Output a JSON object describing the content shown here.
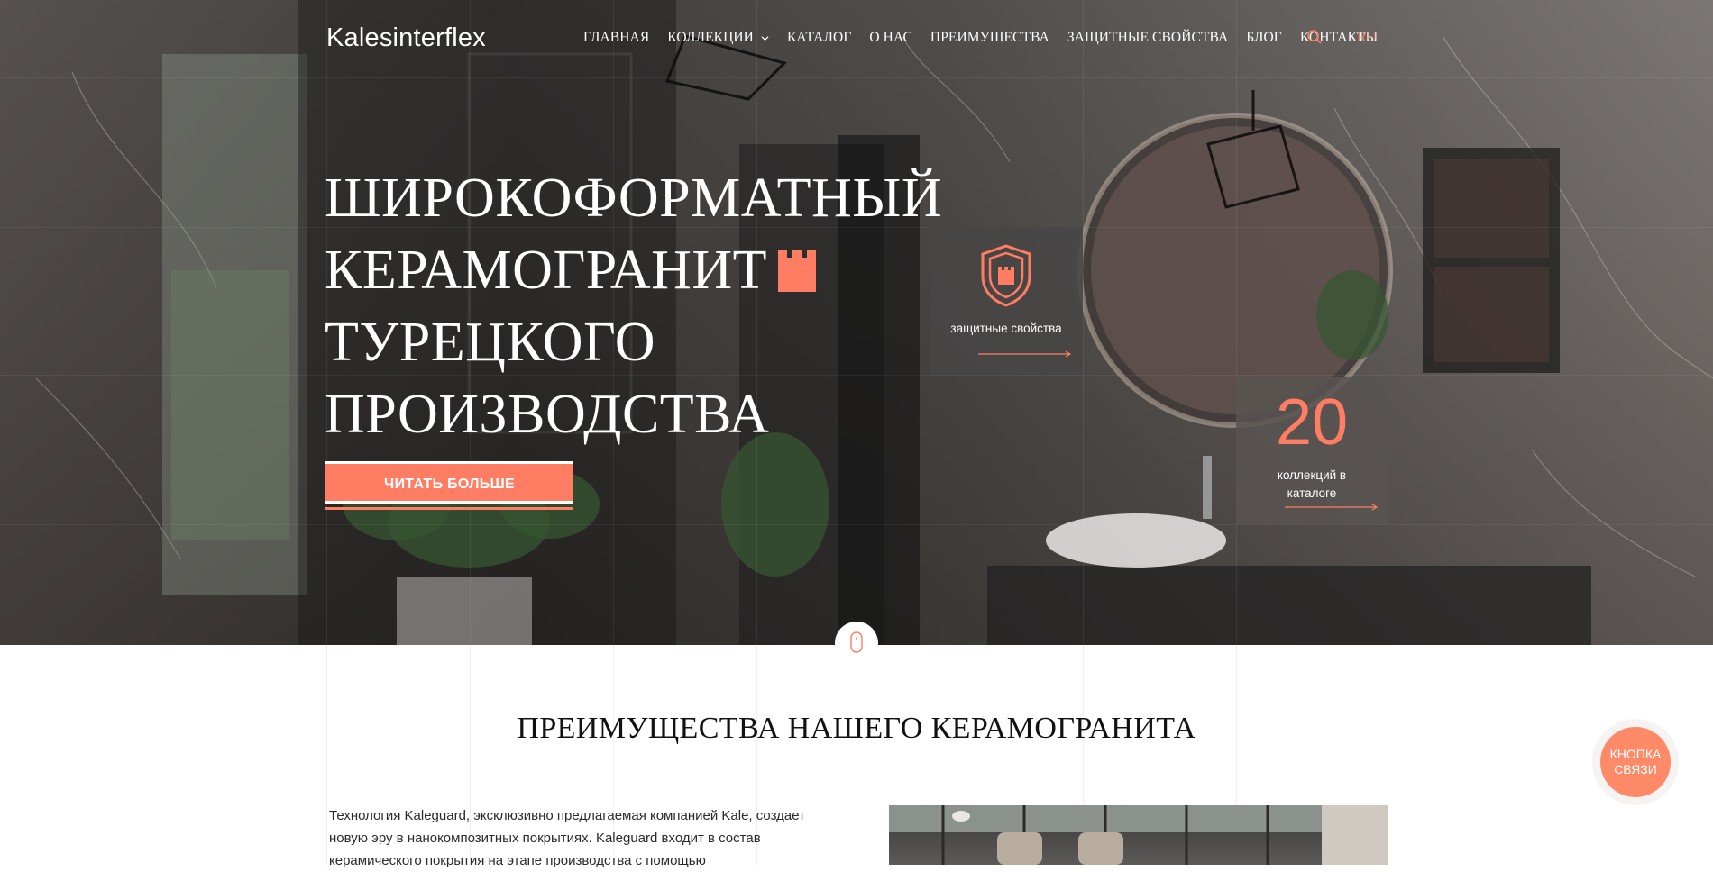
{
  "header": {
    "logo": "Kalesinterflex",
    "nav": [
      {
        "label": "ГЛАВНАЯ"
      },
      {
        "label": "КОЛЛЕКЦИИ"
      },
      {
        "label": "КАТАЛОГ"
      },
      {
        "label": "О НАС"
      },
      {
        "label": "ПРЕИМУЩЕСТВА"
      },
      {
        "label": "ЗАЩИТНЫЕ СВОЙСТВА"
      },
      {
        "label": "БЛОГ"
      },
      {
        "label": "КОНТАКТЫ"
      }
    ],
    "lang": "RU"
  },
  "hero": {
    "headline": [
      "ШИРОКОФОРМАТНЫЙ",
      "КЕРАМОГРАНИТ",
      "ТУРЕЦКОГО",
      "ПРОИЗВОДСТВА"
    ],
    "button": "ЧИТАТЬ БОЛЬШЕ",
    "protect_card": {
      "label": "защитные свойства"
    },
    "count_card": {
      "number": "20",
      "caption_line1": "коллекций в",
      "caption_line2": "каталоге"
    }
  },
  "section": {
    "title": "ПРЕИМУЩЕСТВА НАШЕГО КЕРАМОГРАНИТА",
    "text": "Технология Kaleguard, эксклюзивно предлагаемая компанией Kale, создает новую эру в нанокомпозитных покрытиях. Kaleguard входит в состав керамического покрытия на этапе производства с помощью"
  },
  "contact_button": {
    "line1": "КНОПКА",
    "line2": "СВЯЗИ"
  },
  "colors": {
    "accent": "#ff7e63",
    "text_dark": "#111111",
    "white": "#ffffff"
  },
  "icons": [
    "search-icon",
    "chevron-down-icon",
    "tower-icon",
    "shield-icon",
    "arrow-right-icon",
    "mouse-icon"
  ]
}
